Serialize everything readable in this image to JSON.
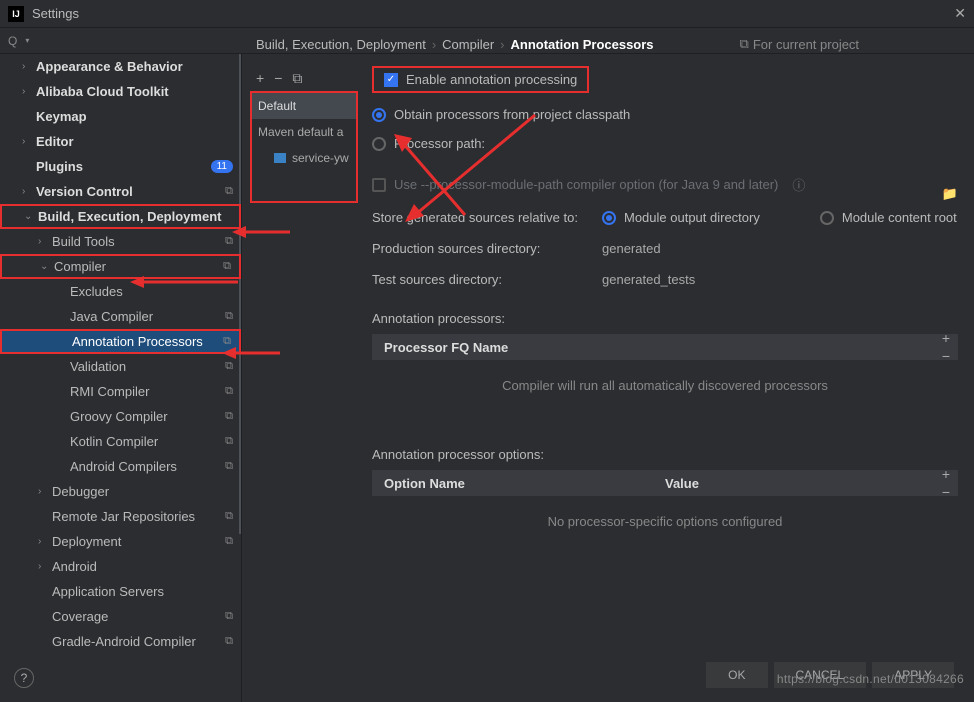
{
  "title": "Settings",
  "breadcrumb": {
    "a": "Build, Execution, Deployment",
    "b": "Compiler",
    "c": "Annotation Processors",
    "badge": "For current project"
  },
  "sidebar": {
    "items": [
      {
        "label": "Appearance & Behavior",
        "chev": "›",
        "bold": true
      },
      {
        "label": "Alibaba Cloud Toolkit",
        "chev": "›",
        "bold": true
      },
      {
        "label": "Keymap",
        "bold": true
      },
      {
        "label": "Editor",
        "chev": "›",
        "bold": true
      },
      {
        "label": "Plugins",
        "bold": true,
        "count": "11"
      },
      {
        "label": "Version Control",
        "chev": "›",
        "bold": true,
        "copy": true
      },
      {
        "label": "Build, Execution, Deployment",
        "chev": "⌄",
        "bold": true,
        "red": true
      },
      {
        "label": "Build Tools",
        "chev": "›",
        "ind": 2,
        "copy": true
      },
      {
        "label": "Compiler",
        "chev": "⌄",
        "ind": 2,
        "copy": true,
        "red": true
      },
      {
        "label": "Excludes",
        "ind": 3
      },
      {
        "label": "Java Compiler",
        "ind": 3,
        "copy": true
      },
      {
        "label": "Annotation Processors",
        "ind": 3,
        "copy": true,
        "red": true,
        "selected": true
      },
      {
        "label": "Validation",
        "ind": 3,
        "copy": true
      },
      {
        "label": "RMI Compiler",
        "ind": 3,
        "copy": true
      },
      {
        "label": "Groovy Compiler",
        "ind": 3,
        "copy": true
      },
      {
        "label": "Kotlin Compiler",
        "ind": 3,
        "copy": true
      },
      {
        "label": "Android Compilers",
        "ind": 3,
        "copy": true
      },
      {
        "label": "Debugger",
        "chev": "›",
        "ind": 2
      },
      {
        "label": "Remote Jar Repositories",
        "ind": 2,
        "copy": true
      },
      {
        "label": "Deployment",
        "chev": "›",
        "ind": 2,
        "copy": true
      },
      {
        "label": "Android",
        "chev": "›",
        "ind": 2
      },
      {
        "label": "Application Servers",
        "ind": 2
      },
      {
        "label": "Coverage",
        "ind": 2,
        "copy": true
      },
      {
        "label": "Gradle-Android Compiler",
        "ind": 2,
        "copy": true
      }
    ]
  },
  "profiles": {
    "add": "+",
    "remove": "−",
    "copy": "⧉",
    "entries": [
      {
        "label": "Default",
        "sel": true
      },
      {
        "label": "Maven default a"
      },
      {
        "label": "service-yw",
        "nested": true
      }
    ]
  },
  "form": {
    "enable": "Enable annotation processing",
    "radio_classpath": "Obtain processors from project classpath",
    "radio_path": "Processor path:",
    "module_path_opt": "Use --processor-module-path compiler option (for Java 9 and later)",
    "store_label": "Store generated sources relative to:",
    "store_a": "Module output directory",
    "store_b": "Module content root",
    "prod_label": "Production sources directory:",
    "prod_val": "generated",
    "test_label": "Test sources directory:",
    "test_val": "generated_tests",
    "proc_label": "Annotation processors:",
    "proc_col": "Processor FQ Name",
    "proc_empty": "Compiler will run all automatically discovered processors",
    "opt_label": "Annotation processor options:",
    "opt_col_a": "Option Name",
    "opt_col_b": "Value",
    "opt_empty": "No processor-specific options configured"
  },
  "buttons": {
    "ok": "OK",
    "cancel": "CANCEL",
    "apply": "APPLY"
  },
  "watermark": "https://blog.csdn.net/u013084266"
}
